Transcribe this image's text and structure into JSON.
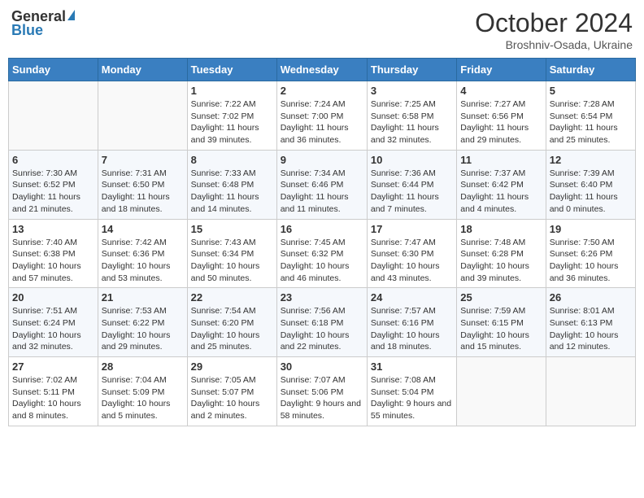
{
  "header": {
    "logo_general": "General",
    "logo_blue": "Blue",
    "month_title": "October 2024",
    "location": "Broshniv-Osada, Ukraine"
  },
  "weekdays": [
    "Sunday",
    "Monday",
    "Tuesday",
    "Wednesday",
    "Thursday",
    "Friday",
    "Saturday"
  ],
  "weeks": [
    [
      {
        "day": "",
        "info": ""
      },
      {
        "day": "",
        "info": ""
      },
      {
        "day": "1",
        "info": "Sunrise: 7:22 AM\nSunset: 7:02 PM\nDaylight: 11 hours and 39 minutes."
      },
      {
        "day": "2",
        "info": "Sunrise: 7:24 AM\nSunset: 7:00 PM\nDaylight: 11 hours and 36 minutes."
      },
      {
        "day": "3",
        "info": "Sunrise: 7:25 AM\nSunset: 6:58 PM\nDaylight: 11 hours and 32 minutes."
      },
      {
        "day": "4",
        "info": "Sunrise: 7:27 AM\nSunset: 6:56 PM\nDaylight: 11 hours and 29 minutes."
      },
      {
        "day": "5",
        "info": "Sunrise: 7:28 AM\nSunset: 6:54 PM\nDaylight: 11 hours and 25 minutes."
      }
    ],
    [
      {
        "day": "6",
        "info": "Sunrise: 7:30 AM\nSunset: 6:52 PM\nDaylight: 11 hours and 21 minutes."
      },
      {
        "day": "7",
        "info": "Sunrise: 7:31 AM\nSunset: 6:50 PM\nDaylight: 11 hours and 18 minutes."
      },
      {
        "day": "8",
        "info": "Sunrise: 7:33 AM\nSunset: 6:48 PM\nDaylight: 11 hours and 14 minutes."
      },
      {
        "day": "9",
        "info": "Sunrise: 7:34 AM\nSunset: 6:46 PM\nDaylight: 11 hours and 11 minutes."
      },
      {
        "day": "10",
        "info": "Sunrise: 7:36 AM\nSunset: 6:44 PM\nDaylight: 11 hours and 7 minutes."
      },
      {
        "day": "11",
        "info": "Sunrise: 7:37 AM\nSunset: 6:42 PM\nDaylight: 11 hours and 4 minutes."
      },
      {
        "day": "12",
        "info": "Sunrise: 7:39 AM\nSunset: 6:40 PM\nDaylight: 11 hours and 0 minutes."
      }
    ],
    [
      {
        "day": "13",
        "info": "Sunrise: 7:40 AM\nSunset: 6:38 PM\nDaylight: 10 hours and 57 minutes."
      },
      {
        "day": "14",
        "info": "Sunrise: 7:42 AM\nSunset: 6:36 PM\nDaylight: 10 hours and 53 minutes."
      },
      {
        "day": "15",
        "info": "Sunrise: 7:43 AM\nSunset: 6:34 PM\nDaylight: 10 hours and 50 minutes."
      },
      {
        "day": "16",
        "info": "Sunrise: 7:45 AM\nSunset: 6:32 PM\nDaylight: 10 hours and 46 minutes."
      },
      {
        "day": "17",
        "info": "Sunrise: 7:47 AM\nSunset: 6:30 PM\nDaylight: 10 hours and 43 minutes."
      },
      {
        "day": "18",
        "info": "Sunrise: 7:48 AM\nSunset: 6:28 PM\nDaylight: 10 hours and 39 minutes."
      },
      {
        "day": "19",
        "info": "Sunrise: 7:50 AM\nSunset: 6:26 PM\nDaylight: 10 hours and 36 minutes."
      }
    ],
    [
      {
        "day": "20",
        "info": "Sunrise: 7:51 AM\nSunset: 6:24 PM\nDaylight: 10 hours and 32 minutes."
      },
      {
        "day": "21",
        "info": "Sunrise: 7:53 AM\nSunset: 6:22 PM\nDaylight: 10 hours and 29 minutes."
      },
      {
        "day": "22",
        "info": "Sunrise: 7:54 AM\nSunset: 6:20 PM\nDaylight: 10 hours and 25 minutes."
      },
      {
        "day": "23",
        "info": "Sunrise: 7:56 AM\nSunset: 6:18 PM\nDaylight: 10 hours and 22 minutes."
      },
      {
        "day": "24",
        "info": "Sunrise: 7:57 AM\nSunset: 6:16 PM\nDaylight: 10 hours and 18 minutes."
      },
      {
        "day": "25",
        "info": "Sunrise: 7:59 AM\nSunset: 6:15 PM\nDaylight: 10 hours and 15 minutes."
      },
      {
        "day": "26",
        "info": "Sunrise: 8:01 AM\nSunset: 6:13 PM\nDaylight: 10 hours and 12 minutes."
      }
    ],
    [
      {
        "day": "27",
        "info": "Sunrise: 7:02 AM\nSunset: 5:11 PM\nDaylight: 10 hours and 8 minutes."
      },
      {
        "day": "28",
        "info": "Sunrise: 7:04 AM\nSunset: 5:09 PM\nDaylight: 10 hours and 5 minutes."
      },
      {
        "day": "29",
        "info": "Sunrise: 7:05 AM\nSunset: 5:07 PM\nDaylight: 10 hours and 2 minutes."
      },
      {
        "day": "30",
        "info": "Sunrise: 7:07 AM\nSunset: 5:06 PM\nDaylight: 9 hours and 58 minutes."
      },
      {
        "day": "31",
        "info": "Sunrise: 7:08 AM\nSunset: 5:04 PM\nDaylight: 9 hours and 55 minutes."
      },
      {
        "day": "",
        "info": ""
      },
      {
        "day": "",
        "info": ""
      }
    ]
  ]
}
